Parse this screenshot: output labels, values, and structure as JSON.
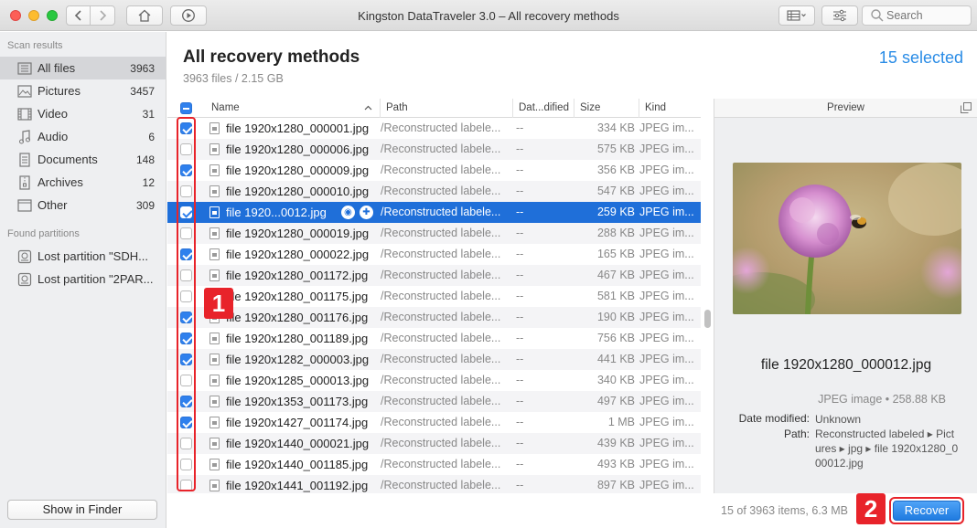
{
  "window": {
    "title": "Kingston DataTraveler 3.0 – All recovery methods",
    "search_placeholder": "Search"
  },
  "sidebar": {
    "scan_results_label": "Scan results",
    "items": [
      {
        "label": "All files",
        "count": "3963",
        "icon": "all-files-icon",
        "active": true
      },
      {
        "label": "Pictures",
        "count": "3457",
        "icon": "pictures-icon"
      },
      {
        "label": "Video",
        "count": "31",
        "icon": "video-icon"
      },
      {
        "label": "Audio",
        "count": "6",
        "icon": "music-note-icon"
      },
      {
        "label": "Documents",
        "count": "148",
        "icon": "document-icon"
      },
      {
        "label": "Archives",
        "count": "12",
        "icon": "archive-icon"
      },
      {
        "label": "Other",
        "count": "309",
        "icon": "other-icon"
      }
    ],
    "found_partitions_label": "Found partitions",
    "partitions": [
      {
        "label": "Lost partition \"SDH..."
      },
      {
        "label": "Lost partition \"2PAR..."
      }
    ],
    "show_in_finder": "Show in Finder"
  },
  "main": {
    "title": "All recovery methods",
    "subtitle": "3963 files / 2.15 GB",
    "selected_label": "15 selected"
  },
  "table": {
    "columns": [
      "Name",
      "Path",
      "Dat...dified",
      "Size",
      "Kind"
    ],
    "rows": [
      {
        "name": "file 1920x1280_000001.jpg",
        "path": "/Reconstructed labele...",
        "date": "--",
        "size": "334 KB",
        "kind": "JPEG im...",
        "checked": true
      },
      {
        "name": "file 1920x1280_000006.jpg",
        "path": "/Reconstructed labele...",
        "date": "--",
        "size": "575 KB",
        "kind": "JPEG im...",
        "checked": false
      },
      {
        "name": "file 1920x1280_000009.jpg",
        "path": "/Reconstructed labele...",
        "date": "--",
        "size": "356 KB",
        "kind": "JPEG im...",
        "checked": true
      },
      {
        "name": "file 1920x1280_000010.jpg",
        "path": "/Reconstructed labele...",
        "date": "--",
        "size": "547 KB",
        "kind": "JPEG im...",
        "checked": false
      },
      {
        "name": "file 1920...0012.jpg",
        "path": "/Reconstructed labele...",
        "date": "--",
        "size": "259 KB",
        "kind": "JPEG im...",
        "checked": true,
        "selected": true
      },
      {
        "name": "file 1920x1280_000019.jpg",
        "path": "/Reconstructed labele...",
        "date": "--",
        "size": "288 KB",
        "kind": "JPEG im...",
        "checked": false
      },
      {
        "name": "file 1920x1280_000022.jpg",
        "path": "/Reconstructed labele...",
        "date": "--",
        "size": "165 KB",
        "kind": "JPEG im...",
        "checked": true
      },
      {
        "name": "file 1920x1280_001172.jpg",
        "path": "/Reconstructed labele...",
        "date": "--",
        "size": "467 KB",
        "kind": "JPEG im...",
        "checked": false
      },
      {
        "name": "file 1920x1280_001175.jpg",
        "path": "/Reconstructed labele...",
        "date": "--",
        "size": "581 KB",
        "kind": "JPEG im...",
        "checked": false
      },
      {
        "name": "file 1920x1280_001176.jpg",
        "path": "/Reconstructed labele...",
        "date": "--",
        "size": "190 KB",
        "kind": "JPEG im...",
        "checked": true
      },
      {
        "name": "file 1920x1280_001189.jpg",
        "path": "/Reconstructed labele...",
        "date": "--",
        "size": "756 KB",
        "kind": "JPEG im...",
        "checked": true
      },
      {
        "name": "file 1920x1282_000003.jpg",
        "path": "/Reconstructed labele...",
        "date": "--",
        "size": "441 KB",
        "kind": "JPEG im...",
        "checked": true
      },
      {
        "name": "file 1920x1285_000013.jpg",
        "path": "/Reconstructed labele...",
        "date": "--",
        "size": "340 KB",
        "kind": "JPEG im...",
        "checked": false
      },
      {
        "name": "file 1920x1353_001173.jpg",
        "path": "/Reconstructed labele...",
        "date": "--",
        "size": "497 KB",
        "kind": "JPEG im...",
        "checked": true
      },
      {
        "name": "file 1920x1427_001174.jpg",
        "path": "/Reconstructed labele...",
        "date": "--",
        "size": "1 MB",
        "kind": "JPEG im...",
        "checked": true
      },
      {
        "name": "file 1920x1440_000021.jpg",
        "path": "/Reconstructed labele...",
        "date": "--",
        "size": "439 KB",
        "kind": "JPEG im...",
        "checked": false
      },
      {
        "name": "file 1920x1440_001185.jpg",
        "path": "/Reconstructed labele...",
        "date": "--",
        "size": "493 KB",
        "kind": "JPEG im...",
        "checked": false
      },
      {
        "name": "file 1920x1441_001192.jpg",
        "path": "/Reconstructed labele...",
        "date": "--",
        "size": "897 KB",
        "kind": "JPEG im...",
        "checked": false
      }
    ]
  },
  "preview": {
    "header": "Preview",
    "file_name": "file 1920x1280_000012.jpg",
    "type_size": "JPEG image • 258.88 KB",
    "date_modified_label": "Date modified:",
    "date_modified_value": "Unknown",
    "path_label": "Path:",
    "path_value_lines": [
      "Reconstructed labeled ▸ Pict",
      "ures ▸ jpg ▸ file 1920x1280_0",
      "00012.jpg"
    ]
  },
  "footer": {
    "count_text": "15 of 3963 items, 6.3 MB",
    "recover_label": "Recover"
  },
  "annotations": {
    "badge_1": "1",
    "badge_2": "2",
    "color": "#e8232a"
  },
  "colors": {
    "accent": "#2a8ce6",
    "selection": "#1f6fd9"
  }
}
